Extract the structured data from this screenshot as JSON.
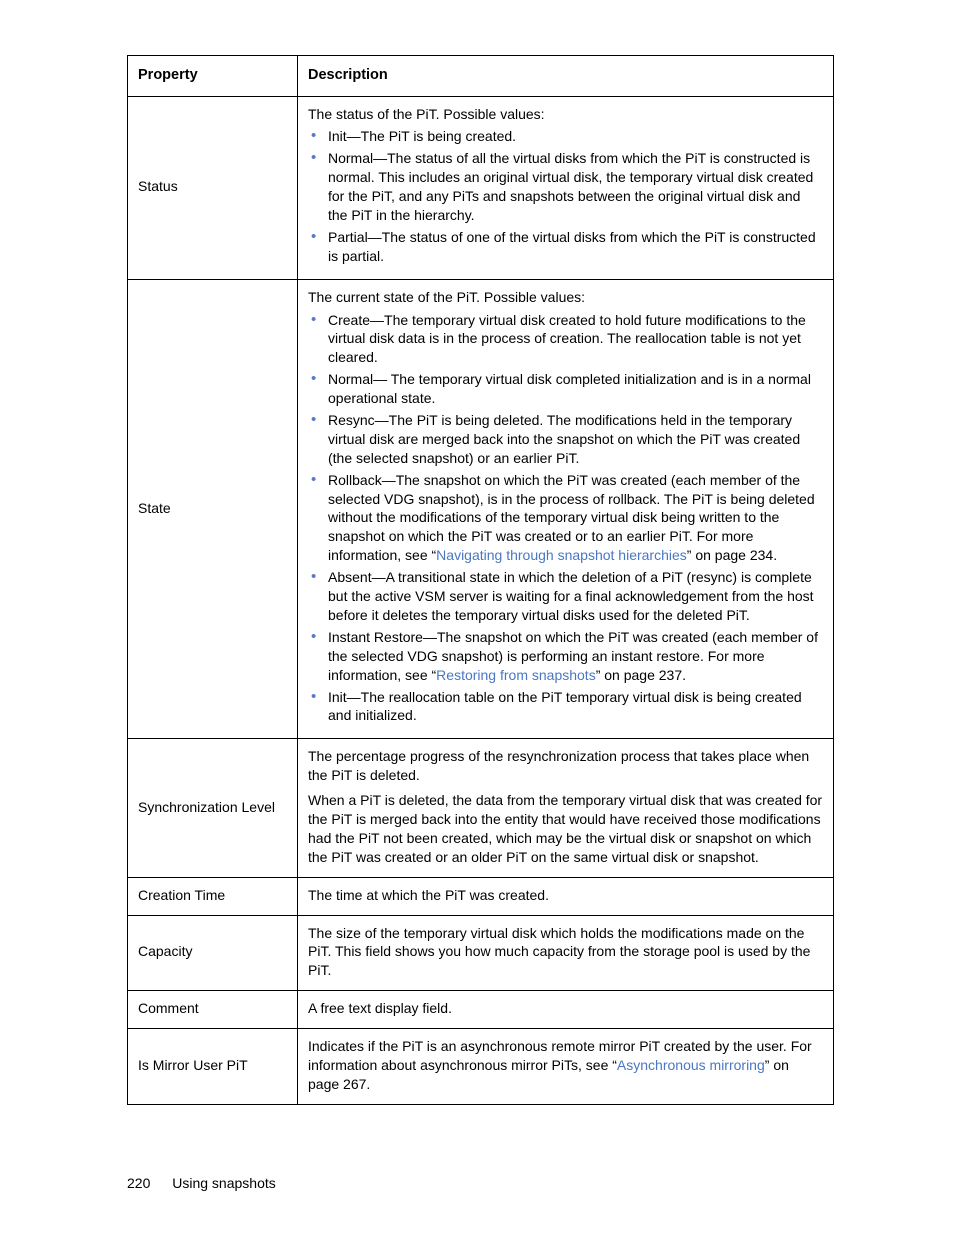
{
  "headers": {
    "property": "Property",
    "description": "Description"
  },
  "rows": {
    "status": {
      "name": "Status",
      "lead": "The status of the PiT. Possible values:",
      "b1": "Init—The PiT is being created.",
      "b2": "Normal—The status of all the virtual disks from which the PiT is constructed is normal. This includes an original virtual disk, the temporary virtual disk created for the PiT, and any PiTs and snapshots between the original virtual disk and the PiT in the hierarchy.",
      "b3": "Partial—The status of one of the virtual disks from which the PiT is constructed is partial."
    },
    "state": {
      "name": "State",
      "lead": "The current state of the PiT. Possible values:",
      "b1": "Create—The temporary virtual disk created to hold future modifications to the virtual disk data is in the process of creation. The reallocation table is not yet cleared.",
      "b2": "Normal— The temporary virtual disk completed initialization and is in a normal operational state.",
      "b3": "Resync—The PiT is being deleted. The modifications held in the temporary virtual disk are merged back into the snapshot on which the PiT was created (the selected snapshot) or an earlier PiT.",
      "b4a": "Rollback—The snapshot on which the PiT was created (each member of the selected VDG snapshot), is in the process of rollback. The PiT is being deleted without the modifications of the temporary virtual disk being written to the snapshot on which the PiT was created or to an earlier PiT. For more information, see “",
      "b4link": "Navigating through snapshot hierarchies",
      "b4b": "” on page 234.",
      "b5": "Absent—A transitional state in which the deletion of a PiT (resync) is complete but the active VSM server is waiting for a final acknowledgement from the host before it deletes the temporary virtual disks used for the deleted PiT.",
      "b6a": "Instant Restore—The snapshot on which the PiT was created (each member of the selected VDG snapshot) is performing an instant restore. For more information, see “",
      "b6link": "Restoring from snapshots",
      "b6b": "” on page 237.",
      "b7": "Init—The reallocation table on the PiT temporary virtual disk is being created and initialized."
    },
    "sync": {
      "name": "Synchronization Level",
      "p1": "The percentage progress of the resynchronization process that takes place when the PiT is deleted.",
      "p2": "When a PiT is deleted, the data from the temporary virtual disk that was created for the PiT is merged back into the entity that would have received those modifications had the PiT not been created, which may be the virtual disk or snapshot on which the PiT was created or an older PiT on the same virtual disk or snapshot."
    },
    "creation": {
      "name": "Creation Time",
      "p1": "The time at which the PiT was created."
    },
    "capacity": {
      "name": "Capacity",
      "p1": "The size of the temporary virtual disk which holds the modifications made on the PiT. This field shows you how much capacity from the storage pool is used by the PiT."
    },
    "comment": {
      "name": "Comment",
      "p1": "A free text display field."
    },
    "mirror": {
      "name": "Is Mirror User PiT",
      "p1a": "Indicates if the PiT is an asynchronous remote mirror PiT created by the user. For information about asynchronous mirror PiTs, see “",
      "p1link": "Asynchronous mirroring",
      "p1b": "” on page 267."
    }
  },
  "footer": {
    "page": "220",
    "section": "Using snapshots"
  }
}
